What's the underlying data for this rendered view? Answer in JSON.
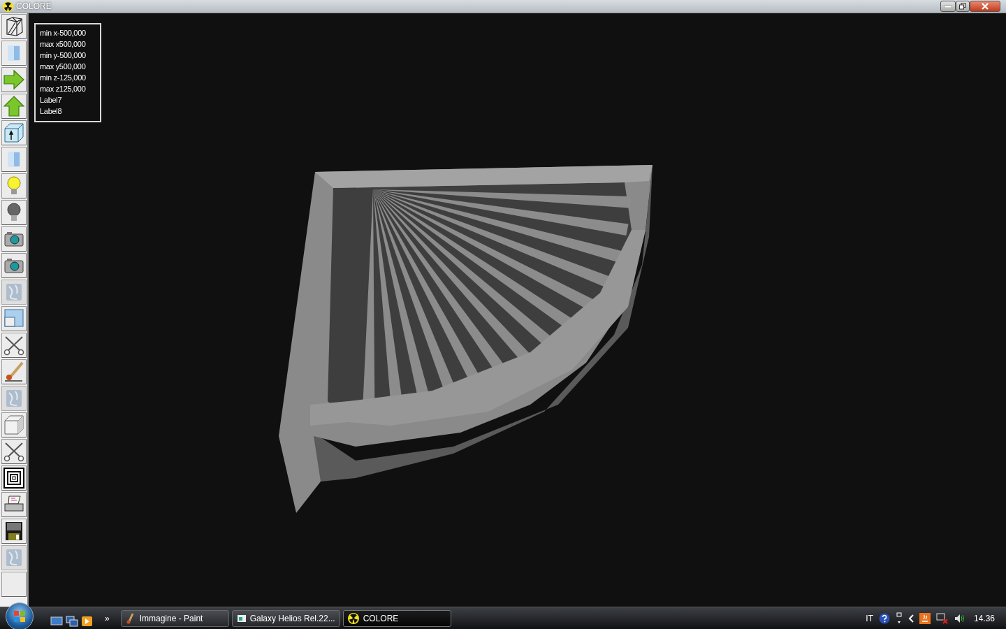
{
  "window": {
    "title": "COLORE"
  },
  "toolbar": [
    {
      "kind": "wireframe",
      "disabled": false
    },
    {
      "kind": "cylinder",
      "disabled": false
    },
    {
      "kind": "arrow-right",
      "disabled": false
    },
    {
      "kind": "arrow-up",
      "disabled": false
    },
    {
      "kind": "box-arrow",
      "disabled": false
    },
    {
      "kind": "cylinder",
      "disabled": false
    },
    {
      "kind": "bulb-on",
      "disabled": false
    },
    {
      "kind": "bulb-off",
      "disabled": false
    },
    {
      "kind": "camera",
      "disabled": false
    },
    {
      "kind": "camera",
      "disabled": false
    },
    {
      "kind": "blank",
      "disabled": true
    },
    {
      "kind": "window",
      "disabled": false
    },
    {
      "kind": "scissors",
      "disabled": false
    },
    {
      "kind": "brush",
      "disabled": false
    },
    {
      "kind": "blank",
      "disabled": true
    },
    {
      "kind": "cube",
      "disabled": false
    },
    {
      "kind": "scissors",
      "disabled": false
    },
    {
      "kind": "squares",
      "disabled": false
    },
    {
      "kind": "printer",
      "disabled": false
    },
    {
      "kind": "floppy",
      "disabled": false
    },
    {
      "kind": "blank",
      "disabled": true
    },
    {
      "kind": "empty",
      "disabled": false
    }
  ],
  "info_panel": {
    "lines": [
      "min x-500,000",
      "max x500,000",
      "min y-500,000",
      "max y500,000",
      "min z-125,000",
      "max z125,000",
      "Label7",
      "Label8"
    ]
  },
  "taskbar": {
    "overflow": "»",
    "tasks": [
      {
        "label": "Immagine - Paint",
        "kind": "paint",
        "selected": false
      },
      {
        "label": "Galaxy Helios  Rel.22...",
        "kind": "doc",
        "selected": false
      },
      {
        "label": "COLORE",
        "kind": "radiation",
        "selected": true
      }
    ],
    "language": "IT",
    "clock": "14.36"
  }
}
